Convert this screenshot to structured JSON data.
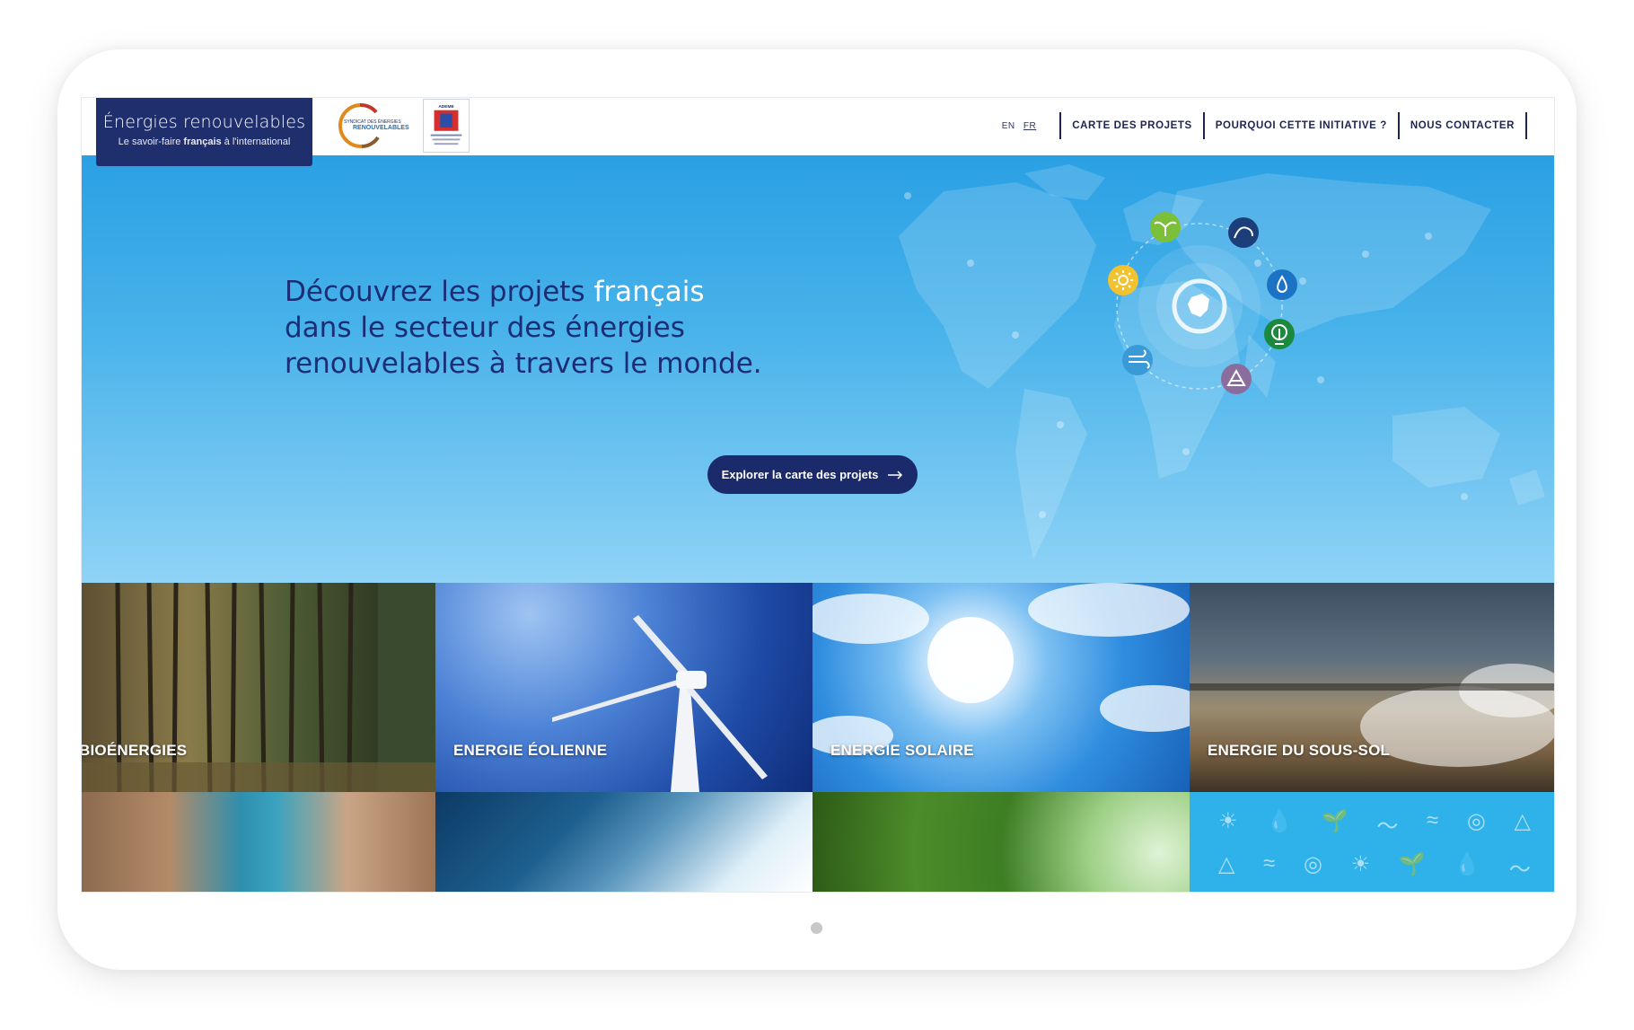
{
  "brand": {
    "title": "Énergies renouvelables",
    "tagline_pre": "Le savoir-faire ",
    "tagline_bold": "français",
    "tagline_post": " à l'international"
  },
  "partners": {
    "ser_line1": "SYNDICAT DES ÉNERGIES",
    "ser_line2": "RENOUVELABLES",
    "ademe": "ADEME"
  },
  "nav": {
    "lang_en": "EN",
    "lang_fr": "FR",
    "items": [
      "CARTE DES PROJETS",
      "POURQUOI CETTE INITIATIVE ?",
      "NOUS CONTACTER"
    ]
  },
  "hero": {
    "line1_pre": "Découvrez les projets ",
    "line1_hl": "français",
    "line2": "dans le secteur des énergies",
    "line3": "renouvelables à travers le monde.",
    "cta": "Explorer la carte des projets",
    "hub_icon": "france-icon",
    "orbit_icons": [
      {
        "name": "plant-icon",
        "color": "#7cbf3a"
      },
      {
        "name": "wave-icon",
        "color": "#1c3f7a"
      },
      {
        "name": "drop-icon",
        "color": "#1c73c4"
      },
      {
        "name": "geothermal-icon",
        "color": "#1b8a3f"
      },
      {
        "name": "mountain-icon",
        "color": "#8a6d9c"
      },
      {
        "name": "wind-icon",
        "color": "#3a9ad8"
      },
      {
        "name": "sun-icon",
        "color": "#f2c230"
      }
    ]
  },
  "tiles": [
    "BIOÉNERGIES",
    "ENERGIE ÉOLIENNE",
    "ENERGIE SOLAIRE",
    "ENERGIE DU SOUS-SOL"
  ],
  "pattern_icons": {
    "row1": [
      "☀",
      "💧",
      "🌱",
      "〜",
      "≈",
      "◎",
      "△"
    ],
    "row2": [
      "△",
      "≈",
      "◎",
      "☀",
      "🌱",
      "💧",
      "〜"
    ]
  }
}
